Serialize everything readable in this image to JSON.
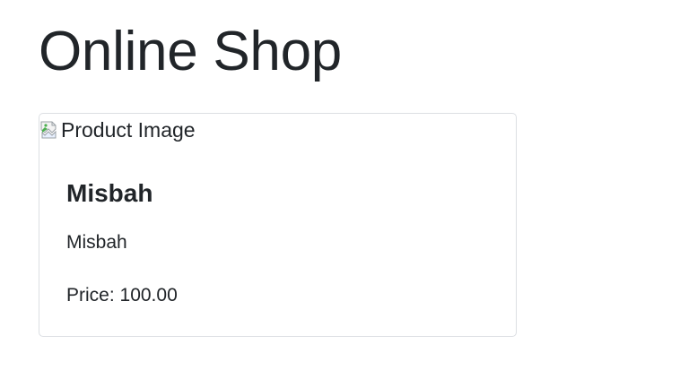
{
  "header": {
    "title": "Online Shop"
  },
  "product": {
    "image_alt": "Product Image",
    "image_icon": "broken-image-icon",
    "name": "Misbah",
    "description": "Misbah",
    "price_text": "Price: 100.00"
  }
}
